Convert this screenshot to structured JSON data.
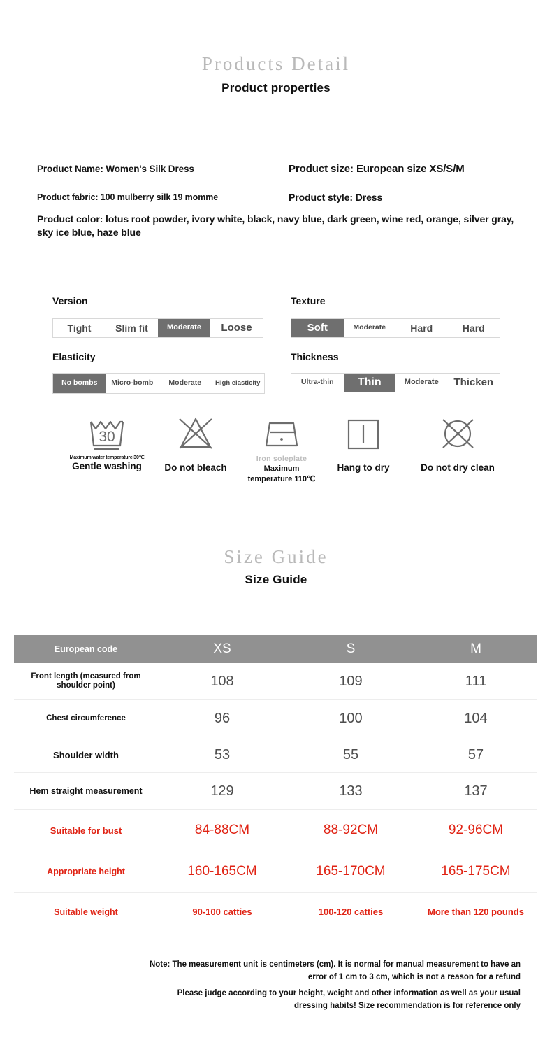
{
  "headings": {
    "products_detail_script": "Products Detail",
    "product_properties": "Product properties",
    "size_guide_script": "Size Guide",
    "size_guide_bold": "Size Guide"
  },
  "product_info": {
    "name": "Product Name: Women's Silk Dress",
    "size": "Product size: European size XS/S/M",
    "fabric": "Product fabric: 100 mulberry silk 19 momme",
    "style": "Product style: Dress",
    "color": "Product color: lotus root powder, ivory white, black, navy blue, dark green, wine red, orange, silver gray, sky ice blue, haze blue"
  },
  "properties": [
    {
      "label": "Version",
      "options": [
        "Tight",
        "Slim fit",
        "Moderate",
        "Loose"
      ],
      "selected_index": 2
    },
    {
      "label": "Texture",
      "options": [
        "Soft",
        "Moderate",
        "Hard",
        "Hard"
      ],
      "selected_index": 0
    },
    {
      "label": "Elasticity",
      "options": [
        "No bombs",
        "Micro-bomb",
        "Moderate",
        "High elasticity"
      ],
      "selected_index": 0
    },
    {
      "label": "Thickness",
      "options": [
        "Ultra-thin",
        "Thin",
        "Moderate",
        "Thicken"
      ],
      "selected_index": 1
    }
  ],
  "care_instructions": [
    {
      "icon": "wash-basin-30-icon",
      "sub": "Maximum water temperature 30℃",
      "sub_style": "dark",
      "main": "Gentle washing",
      "main_lines": ""
    },
    {
      "icon": "no-bleach-triangle-icon",
      "sub": "",
      "sub_style": "dark",
      "main": "Do not bleach",
      "main_lines": ""
    },
    {
      "icon": "iron-one-dot-icon",
      "sub": "Iron soleplate",
      "sub_style": "grey",
      "main": "Maximum",
      "main_lines": "temperature 110℃"
    },
    {
      "icon": "hang-to-dry-icon",
      "sub": "",
      "sub_style": "dark",
      "main": "Hang to dry",
      "main_lines": ""
    },
    {
      "icon": "no-dry-clean-icon",
      "sub": "",
      "sub_style": "dark",
      "main": "Do not dry clean",
      "main_lines": ""
    }
  ],
  "size_table": {
    "header": [
      "European code",
      "XS",
      "S",
      "M"
    ],
    "rows": [
      {
        "label": "Front length (measured from shoulder point)",
        "values": [
          "108",
          "109",
          "111"
        ],
        "style": "normal"
      },
      {
        "label": "Chest circumference",
        "values": [
          "96",
          "100",
          "104"
        ],
        "style": "normal"
      },
      {
        "label": "Shoulder width",
        "values": [
          "53",
          "55",
          "57"
        ],
        "style": "normal"
      },
      {
        "label": "Hem straight measurement",
        "values": [
          "129",
          "133",
          "137"
        ],
        "style": "normal"
      },
      {
        "label": "Suitable for bust",
        "values": [
          "84-88CM",
          "88-92CM",
          "92-96CM"
        ],
        "style": "red"
      },
      {
        "label": "Appropriate height",
        "values": [
          "160-165CM",
          "165-170CM",
          "165-175CM"
        ],
        "style": "red"
      },
      {
        "label": "Suitable weight",
        "values": [
          "90-100 catties",
          "100-120 catties",
          "More than 120 pounds"
        ],
        "style": "red-bold"
      }
    ]
  },
  "note": {
    "line1": "Note: The measurement unit is centimeters (cm). It is normal for manual measurement to have an",
    "line2": "error of 1 cm to 3 cm, which is not a reason for a refund",
    "line3": "Please judge according to your height, weight and other information as well as your usual",
    "line4": "dressing habits! Size recommendation is for reference only"
  },
  "colors": {
    "script_heading": "#b9b9b9",
    "selected_cell": "#6f6f6f",
    "table_header": "#919191",
    "red_text": "#e02314",
    "value_text": "#4e4e4e"
  }
}
